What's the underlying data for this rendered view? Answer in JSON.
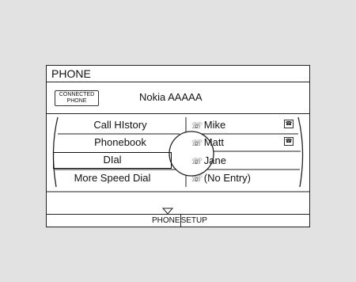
{
  "title": "PHONE",
  "connected": {
    "badge_line1": "CONNECTED",
    "badge_line2": "PHONE",
    "device_name": "Nokia AAAAA"
  },
  "menu": {
    "left": [
      "Call HIstory",
      "Phonebook",
      "DIal",
      "More Speed Dial"
    ],
    "selected_index": 2,
    "right": [
      {
        "name": "Mike",
        "number": "1",
        "has_badge": true
      },
      {
        "name": "Matt",
        "number": "2",
        "has_badge": true
      },
      {
        "name": "Jane",
        "number": "3",
        "has_badge": false
      },
      {
        "name": "(No Entry)",
        "number": "4",
        "has_badge": false
      }
    ]
  },
  "footer": {
    "label_left": "PHONE",
    "label_right": "SETUP"
  },
  "icons": {
    "speed_dial": "handset-icon",
    "contact_badge": "contact-card-icon",
    "scroll": "triangle-down-icon"
  }
}
